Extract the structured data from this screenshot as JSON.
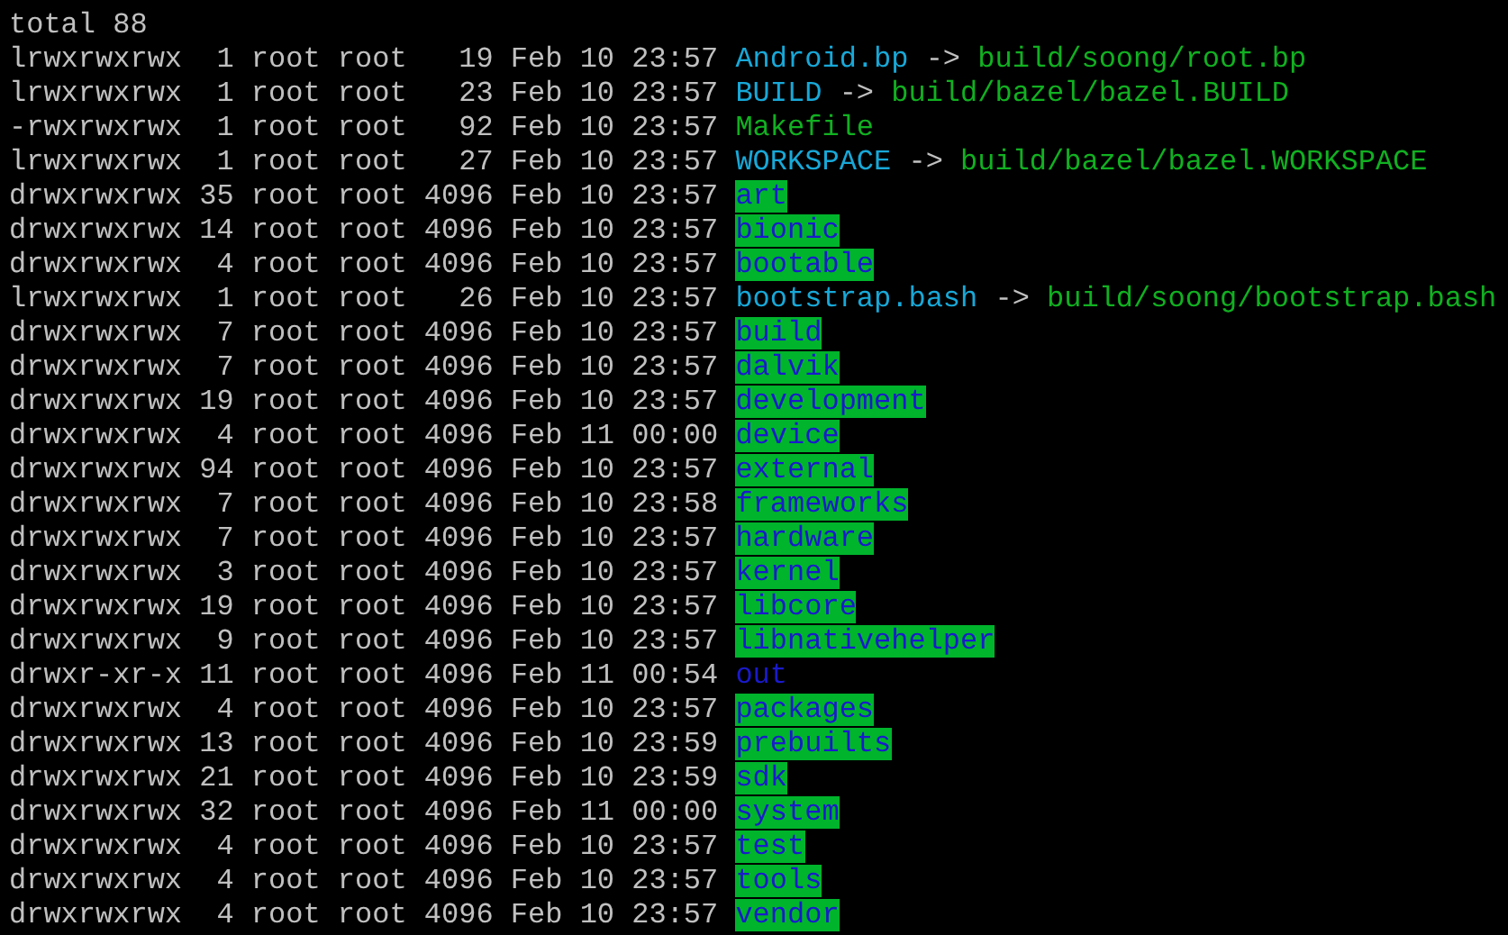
{
  "total": "total 88",
  "entries": [
    {
      "perms": "lrwxrwxrwx",
      "links": "1",
      "owner": "root",
      "group": "root",
      "size": "19",
      "date": "Feb 10",
      "time": "23:57",
      "name": "Android.bp",
      "kind": "link",
      "arrow": "->",
      "target": "build/soong/root.bp"
    },
    {
      "perms": "lrwxrwxrwx",
      "links": "1",
      "owner": "root",
      "group": "root",
      "size": "23",
      "date": "Feb 10",
      "time": "23:57",
      "name": "BUILD",
      "kind": "link",
      "arrow": "->",
      "target": "build/bazel/bazel.BUILD"
    },
    {
      "perms": "-rwxrwxrwx",
      "links": "1",
      "owner": "root",
      "group": "root",
      "size": "92",
      "date": "Feb 10",
      "time": "23:57",
      "name": "Makefile",
      "kind": "file"
    },
    {
      "perms": "lrwxrwxrwx",
      "links": "1",
      "owner": "root",
      "group": "root",
      "size": "27",
      "date": "Feb 10",
      "time": "23:57",
      "name": "WORKSPACE",
      "kind": "link",
      "arrow": "->",
      "target": "build/bazel/bazel.WORKSPACE"
    },
    {
      "perms": "drwxrwxrwx",
      "links": "35",
      "owner": "root",
      "group": "root",
      "size": "4096",
      "date": "Feb 10",
      "time": "23:57",
      "name": "art",
      "kind": "dir_writable"
    },
    {
      "perms": "drwxrwxrwx",
      "links": "14",
      "owner": "root",
      "group": "root",
      "size": "4096",
      "date": "Feb 10",
      "time": "23:57",
      "name": "bionic",
      "kind": "dir_writable"
    },
    {
      "perms": "drwxrwxrwx",
      "links": "4",
      "owner": "root",
      "group": "root",
      "size": "4096",
      "date": "Feb 10",
      "time": "23:57",
      "name": "bootable",
      "kind": "dir_writable"
    },
    {
      "perms": "lrwxrwxrwx",
      "links": "1",
      "owner": "root",
      "group": "root",
      "size": "26",
      "date": "Feb 10",
      "time": "23:57",
      "name": "bootstrap.bash",
      "kind": "link",
      "arrow": "->",
      "target": "build/soong/bootstrap.bash"
    },
    {
      "perms": "drwxrwxrwx",
      "links": "7",
      "owner": "root",
      "group": "root",
      "size": "4096",
      "date": "Feb 10",
      "time": "23:57",
      "name": "build",
      "kind": "dir_writable"
    },
    {
      "perms": "drwxrwxrwx",
      "links": "7",
      "owner": "root",
      "group": "root",
      "size": "4096",
      "date": "Feb 10",
      "time": "23:57",
      "name": "dalvik",
      "kind": "dir_writable"
    },
    {
      "perms": "drwxrwxrwx",
      "links": "19",
      "owner": "root",
      "group": "root",
      "size": "4096",
      "date": "Feb 10",
      "time": "23:57",
      "name": "development",
      "kind": "dir_writable"
    },
    {
      "perms": "drwxrwxrwx",
      "links": "4",
      "owner": "root",
      "group": "root",
      "size": "4096",
      "date": "Feb 11",
      "time": "00:00",
      "name": "device",
      "kind": "dir_writable"
    },
    {
      "perms": "drwxrwxrwx",
      "links": "94",
      "owner": "root",
      "group": "root",
      "size": "4096",
      "date": "Feb 10",
      "time": "23:57",
      "name": "external",
      "kind": "dir_writable"
    },
    {
      "perms": "drwxrwxrwx",
      "links": "7",
      "owner": "root",
      "group": "root",
      "size": "4096",
      "date": "Feb 10",
      "time": "23:58",
      "name": "frameworks",
      "kind": "dir_writable"
    },
    {
      "perms": "drwxrwxrwx",
      "links": "7",
      "owner": "root",
      "group": "root",
      "size": "4096",
      "date": "Feb 10",
      "time": "23:57",
      "name": "hardware",
      "kind": "dir_writable"
    },
    {
      "perms": "drwxrwxrwx",
      "links": "3",
      "owner": "root",
      "group": "root",
      "size": "4096",
      "date": "Feb 10",
      "time": "23:57",
      "name": "kernel",
      "kind": "dir_writable"
    },
    {
      "perms": "drwxrwxrwx",
      "links": "19",
      "owner": "root",
      "group": "root",
      "size": "4096",
      "date": "Feb 10",
      "time": "23:57",
      "name": "libcore",
      "kind": "dir_writable"
    },
    {
      "perms": "drwxrwxrwx",
      "links": "9",
      "owner": "root",
      "group": "root",
      "size": "4096",
      "date": "Feb 10",
      "time": "23:57",
      "name": "libnativehelper",
      "kind": "dir_writable"
    },
    {
      "perms": "drwxr-xr-x",
      "links": "11",
      "owner": "root",
      "group": "root",
      "size": "4096",
      "date": "Feb 11",
      "time": "00:54",
      "name": "out",
      "kind": "dir"
    },
    {
      "perms": "drwxrwxrwx",
      "links": "4",
      "owner": "root",
      "group": "root",
      "size": "4096",
      "date": "Feb 10",
      "time": "23:57",
      "name": "packages",
      "kind": "dir_writable"
    },
    {
      "perms": "drwxrwxrwx",
      "links": "13",
      "owner": "root",
      "group": "root",
      "size": "4096",
      "date": "Feb 10",
      "time": "23:59",
      "name": "prebuilts",
      "kind": "dir_writable"
    },
    {
      "perms": "drwxrwxrwx",
      "links": "21",
      "owner": "root",
      "group": "root",
      "size": "4096",
      "date": "Feb 10",
      "time": "23:59",
      "name": "sdk",
      "kind": "dir_writable"
    },
    {
      "perms": "drwxrwxrwx",
      "links": "32",
      "owner": "root",
      "group": "root",
      "size": "4096",
      "date": "Feb 11",
      "time": "00:00",
      "name": "system",
      "kind": "dir_writable"
    },
    {
      "perms": "drwxrwxrwx",
      "links": "4",
      "owner": "root",
      "group": "root",
      "size": "4096",
      "date": "Feb 10",
      "time": "23:57",
      "name": "test",
      "kind": "dir_writable"
    },
    {
      "perms": "drwxrwxrwx",
      "links": "4",
      "owner": "root",
      "group": "root",
      "size": "4096",
      "date": "Feb 10",
      "time": "23:57",
      "name": "tools",
      "kind": "dir_writable"
    },
    {
      "perms": "drwxrwxrwx",
      "links": "4",
      "owner": "root",
      "group": "root",
      "size": "4096",
      "date": "Feb 10",
      "time": "23:57",
      "name": "vendor",
      "kind": "dir_writable"
    }
  ]
}
